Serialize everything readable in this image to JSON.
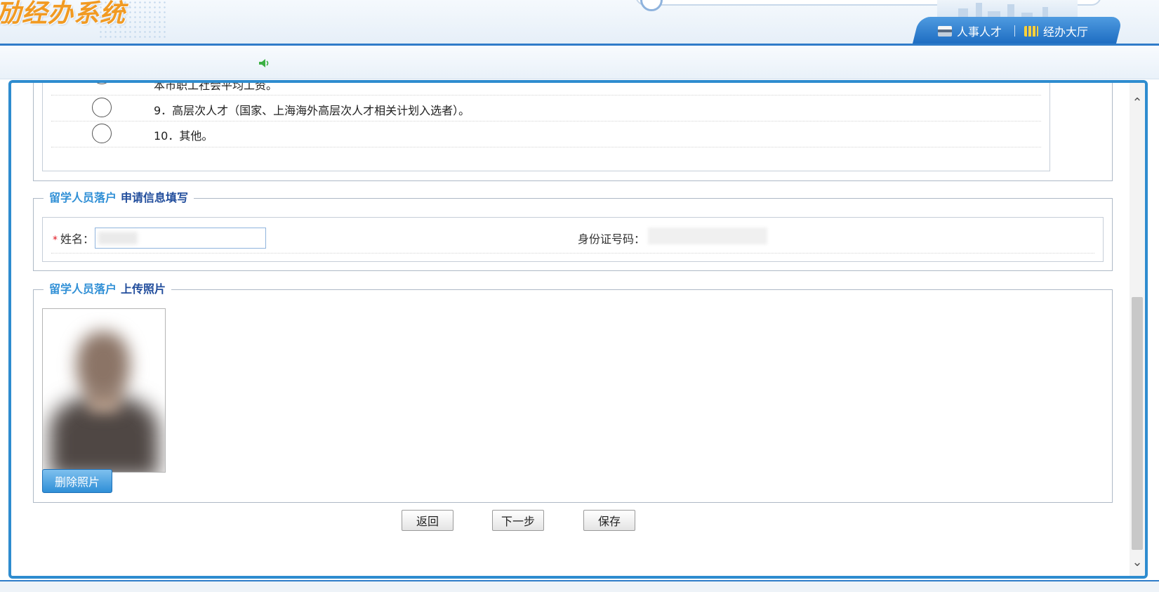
{
  "header": {
    "app_title": "劢经办系统",
    "tabs": [
      {
        "label": "人事人才",
        "icon": "monitor-icon"
      },
      {
        "label": "经办大厅",
        "icon": "building-icon"
      }
    ]
  },
  "options": [
    {
      "text": "本市职工社会平均工资。"
    },
    {
      "text": "9．高层次人才（国家、上海海外高层次人才相关计划入选者）。"
    },
    {
      "text": "10．其他。"
    }
  ],
  "application_section": {
    "legend_a": "留学人员落户",
    "legend_b": "申请信息填写",
    "name_label": "姓名：",
    "name_value": "",
    "id_label": "身份证号码："
  },
  "photo_section": {
    "legend_a": "留学人员落户",
    "legend_b": "上传照片",
    "delete_button": "删除照片"
  },
  "actions": {
    "back": "返回",
    "next": "下一步",
    "save": "保存"
  },
  "colors": {
    "accent_blue": "#2e8ccf",
    "title_orange": "#f19a22",
    "legend_blue_light": "#3190d6",
    "legend_blue_dark": "#214d9c",
    "required_red": "#e0141e"
  }
}
